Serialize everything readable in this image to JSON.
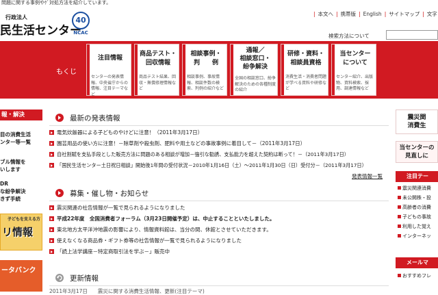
{
  "top_line": "問題に関する事例やｹﾞ対処方法を紹介しています。",
  "header": {
    "org_type": "行政法人",
    "org_name": "民生活センター",
    "emblem_number": "40",
    "emblem_text": "NCAC",
    "links": [
      "本文へ",
      "携帯版",
      "English",
      "サイトマップ",
      "文字"
    ],
    "search_label": "検索方法について"
  },
  "nav": {
    "mokuji": "もくじ",
    "cards": [
      {
        "title": "注目情報",
        "desc": "センターの発表情報、中央省庁からの情報、注目テーマなど"
      },
      {
        "title": "商品テスト・\n回収情報",
        "desc": "商品テスト結果、回収・無償修理情報など"
      },
      {
        "title": "相談事例・\n判　　例",
        "desc": "相談事例、事故情報、相談件数の検索、判例の紹介など"
      },
      {
        "title": "通報／\n相談窓口・\n紛争解決",
        "desc": "全国の相談窓口、紛争解決のための各種制度の紹介"
      },
      {
        "title": "研修・資料・\n相談員資格",
        "desc": "消費生活・消費者問題が学べる資料や研修など"
      },
      {
        "title": "当センター\nについて",
        "desc": "センター紹介、出版物、資料検索、採用、調達情報など"
      }
    ]
  },
  "left": {
    "head": "報・解決",
    "items": [
      "目の消費生活",
      "ンター等一覧",
      "ブル情報を",
      "いします",
      "DR",
      "な紛争解決",
      "きず手続"
    ],
    "banner1": "リ情報",
    "banner1_sub": "子どもを支える方",
    "banner2": "ータバンク"
  },
  "news": {
    "title": "最新の発表情報",
    "items": [
      "電気炊飯器による子どものやけどに注意！（2011年3月17日）",
      "園芸用品の使い方に注意！－除草剤や殺虫剤、肥料や用土などの事故事例に着目して－（2011年3月17日）",
      "自社割賦を支払手段とした販売方法に問題のある相談が増加－強引な勧誘、支払能力を超えた契約は断って！－（2011年3月17日）",
      "「国民生活センター土日祝日相談」開始後1年間の受付状況－2010年1月16日（土）～2011年1月30日（日）受付分－（2011年3月17日）"
    ],
    "more": "発表情報一覧"
  },
  "events": {
    "title": "募集・催し物・お知らせ",
    "items": [
      "震災関連の社告情報が一覧で見られるようになりました",
      "平成22年度　全国消費者フォーラム（3月23日開催予定）は、中止することといたしました。",
      "東北地方太平洋沖地震の影響により、情報資料館は、当分の間、休館とさせていただきます。",
      "使えなくなる商品券・ギフト券等の社告情報が一覧で見られるようになりました",
      "「読上法学講座－特定商取引法を学ぶ－」販売中"
    ]
  },
  "updates": {
    "title": "更新情報",
    "first": "2011年3月17日　　震災に関する消費生活情報、更新(注目テーマ)"
  },
  "right": {
    "box1_line1": "震災関",
    "box1_line2": "消費生",
    "box2_line1": "当センターの",
    "box2_line2": "見直しに",
    "head1": "注目テー",
    "links1": [
      "震災関連消費",
      "未公開株・投",
      "高齢者の消費",
      "子どもの事故",
      "利用した覚え",
      "インターネッ"
    ],
    "head2": "メールマ",
    "links2": [
      "おすすめフレ"
    ]
  }
}
